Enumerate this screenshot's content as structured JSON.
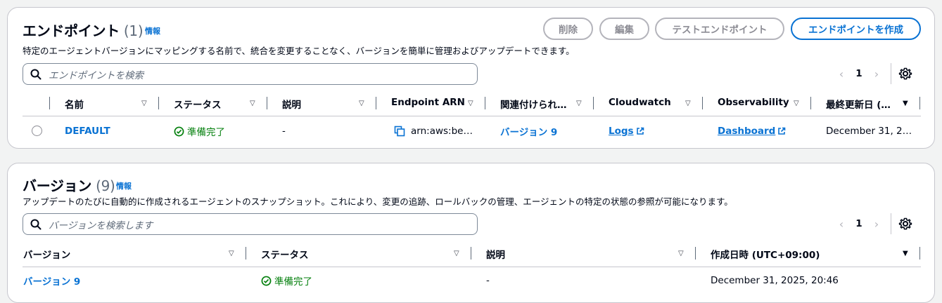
{
  "endpoints": {
    "title": "エンドポイント",
    "count": "(1)",
    "info": "情報",
    "description": "特定のエージェントバージョンにマッピングする名前で、統合を変更することなく、バージョンを簡単に管理およびアップデートできます。",
    "buttons": {
      "delete": "削除",
      "edit": "編集",
      "test": "テストエンドポイント",
      "create": "エンドポイントを作成"
    },
    "search_placeholder": "エンドポイントを検索",
    "page": "1",
    "columns": [
      "名前",
      "ステータス",
      "説明",
      "Endpoint ARN",
      "関連付けられ…",
      "Cloudwatch",
      "Observability",
      "最終更新日 (…"
    ],
    "rows": [
      {
        "name": "DEFAULT",
        "status": "準備完了",
        "description": "-",
        "arn": "arn:aws:be…",
        "version": "バージョン 9",
        "cloudwatch": "Logs",
        "observability": "Dashboard",
        "updated": "December 31, 2…"
      }
    ]
  },
  "versions": {
    "title": "バージョン",
    "count": "(9)",
    "info": "情報",
    "description": "アップデートのたびに自動的に作成されるエージェントのスナップショット。これにより、変更の追跡、ロールバックの管理、エージェントの特定の状態の参照が可能になります。",
    "search_placeholder": "バージョンを検索します",
    "page": "1",
    "columns": [
      "バージョン",
      "ステータス",
      "説明",
      "作成日時 (UTC+09:00)"
    ],
    "rows": [
      {
        "version": "バージョン 9",
        "status": "準備完了",
        "description": "-",
        "created": "December 31, 2025, 20:46"
      }
    ]
  },
  "colors": {
    "link": "#0972d3",
    "success": "#037f0c",
    "border": "#c6c6cd"
  }
}
